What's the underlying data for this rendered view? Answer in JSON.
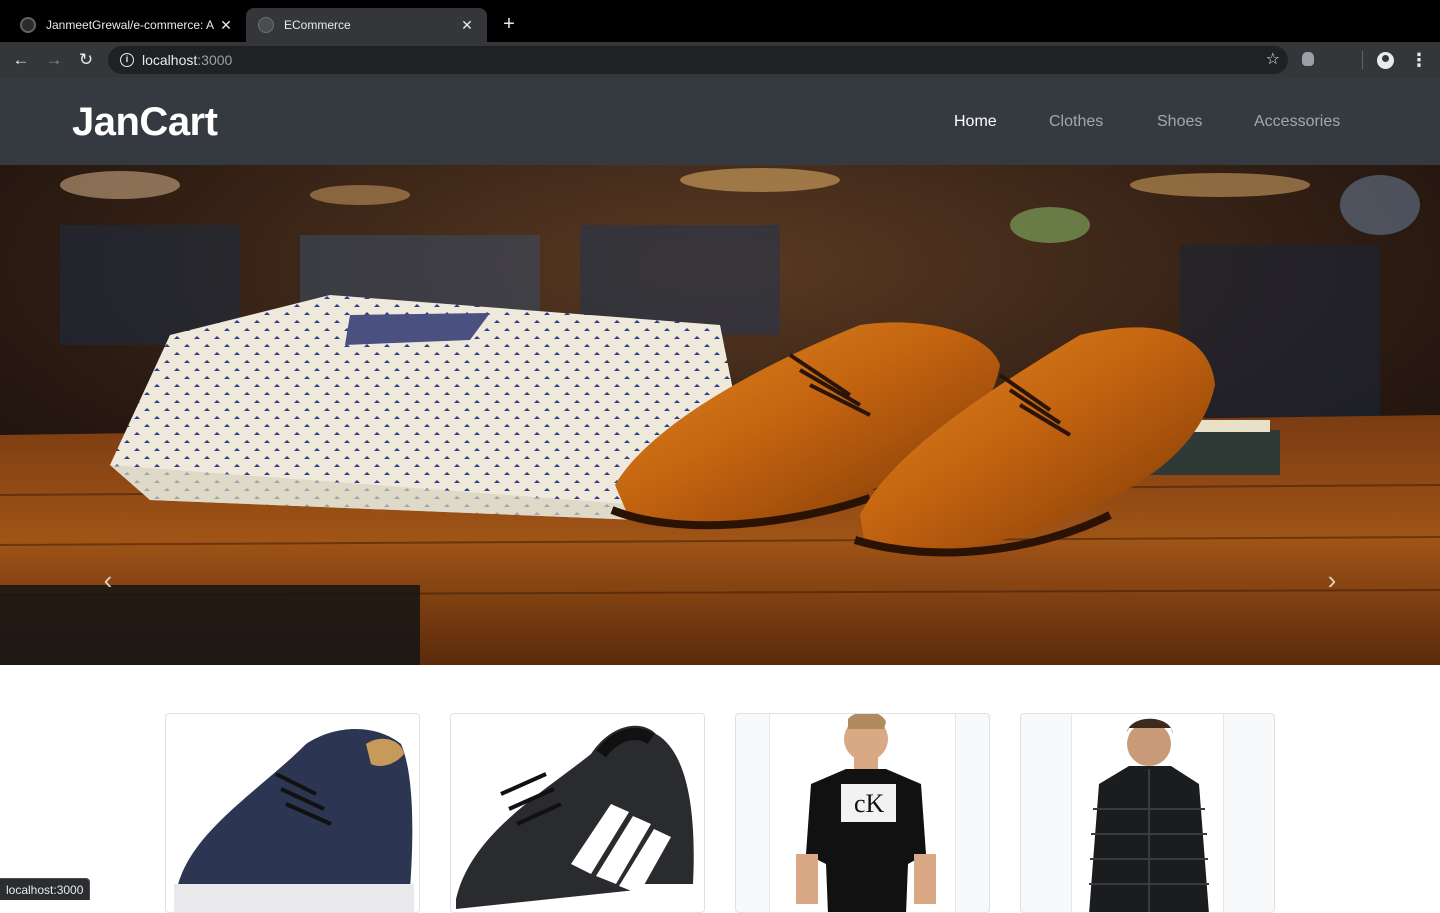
{
  "browser": {
    "tabs": [
      {
        "title": "JanmeetGrewal/e-commerce: A",
        "close": "✕"
      },
      {
        "title": "ECommerce",
        "close": "✕"
      }
    ],
    "new_tab": "+",
    "back": "←",
    "forward": "→",
    "reload": "↻",
    "info": "i",
    "url_host": "localhost",
    "url_port": ":3000",
    "star": "☆",
    "menu": "⋮",
    "status_url": "localhost:3000"
  },
  "site": {
    "brand": "JanCart",
    "nav": [
      {
        "label": "Home",
        "active": true
      },
      {
        "label": "Clothes",
        "active": false
      },
      {
        "label": "Shoes",
        "active": false
      },
      {
        "label": "Accessories",
        "active": false
      }
    ],
    "carousel": {
      "prev": "‹",
      "next": "›"
    }
  },
  "products": [
    {
      "kind": "shoe",
      "color": "navy"
    },
    {
      "kind": "sneaker",
      "color": "black"
    },
    {
      "kind": "tshirt",
      "color": "black"
    },
    {
      "kind": "jacket",
      "color": "black"
    }
  ],
  "colors": {
    "navbar_bg": "#343a40",
    "nav_active": "#ffffff",
    "nav_inactive": "rgba(255,255,255,0.55)",
    "browser_bg": "#000000",
    "toolbar_bg": "#35363a"
  }
}
